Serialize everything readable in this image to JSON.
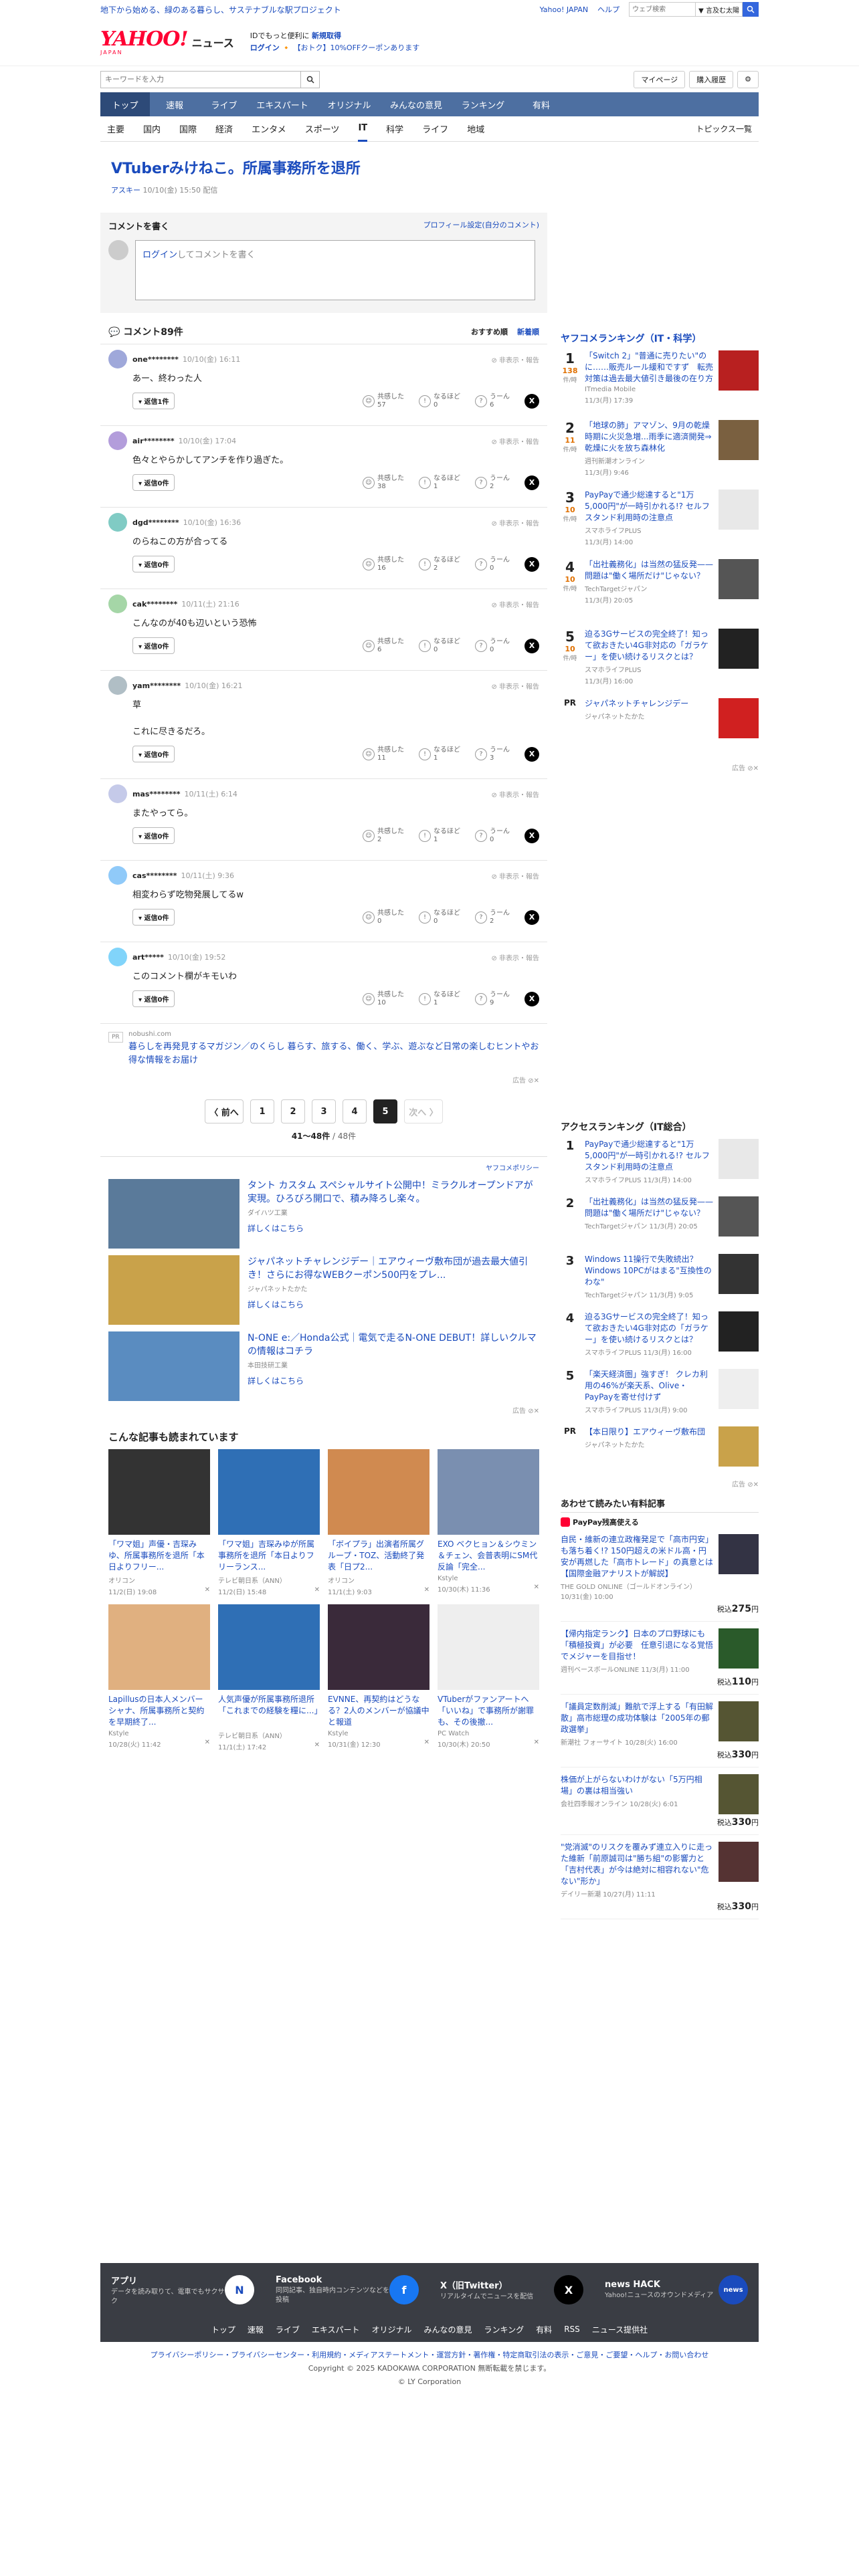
{
  "topbar": {
    "promo": "地下から始める、緑のある暮らし、サステナブルな駅プロジェクト",
    "links": [
      "Yahoo! JAPAN",
      "ヘルプ"
    ],
    "search_placeholder": "ウェブ検索",
    "search_button": "▼ 言及む太陽",
    "search_icon": "search-icon"
  },
  "header": {
    "logo": "YAHOO!",
    "logo_sub": "JAPAN",
    "section": "ニュース",
    "line1": "IDでもっと便利に",
    "line1_bold": "新規取得",
    "login": "ログイン",
    "line2": "【おトク】10%OFFクーポンあります"
  },
  "searchrow": {
    "placeholder": "キーワードを入力",
    "mypage": "マイページ",
    "purchase": "購入履歴",
    "settings_icon": "gear-icon"
  },
  "nav": [
    "トップ",
    "速報",
    "ライブ",
    "エキスパート",
    "オリジナル",
    "みんなの意見",
    "ランキング",
    "有料"
  ],
  "categories": [
    "主要",
    "国内",
    "国際",
    "経済",
    "エンタメ",
    "スポーツ",
    "IT",
    "科学",
    "ライフ",
    "地域"
  ],
  "topics_link": "トピックス一覧",
  "article": {
    "title": "VTuberみけねこ。所属事務所を退所",
    "source": "アスキー",
    "date": "10/10(金) 15:50 配信"
  },
  "comment_form": {
    "title": "コメントを書く",
    "profile_link": "プロフィール設定(自分のコメント)",
    "login_text": "ログイン",
    "prompt_text": "してコメントを書く"
  },
  "comments_head": {
    "title": "コメント89件",
    "sort_recommend": "おすすめ順",
    "sort_new": "新着順"
  },
  "labels": {
    "report": "非表示・報告",
    "reply": "返信",
    "empathy": "共感した",
    "naruhodo": "なるほど",
    "uun": "うーん"
  },
  "comments": [
    {
      "name": "one********",
      "date": "10/10(金) 16:11",
      "text": "あー、終わった人",
      "reply": "返信1件",
      "e": "57",
      "n": "0",
      "u": "6",
      "color": "#9fa8da"
    },
    {
      "name": "air********",
      "date": "10/10(金) 17:04",
      "text": "色々とやらかしてアンチを作り過ぎた。",
      "reply": "返信0件",
      "e": "38",
      "n": "1",
      "u": "2",
      "color": "#b39ddb"
    },
    {
      "name": "dgd********",
      "date": "10/10(金) 16:36",
      "text": "のらねこの方が合ってる",
      "reply": "返信0件",
      "e": "16",
      "n": "2",
      "u": "0",
      "color": "#80cbc4"
    },
    {
      "name": "cak********",
      "date": "10/11(土) 21:16",
      "text": "こんなのが40も辺いという恐怖",
      "reply": "返信0件",
      "e": "6",
      "n": "0",
      "u": "0",
      "color": "#a5d6a7"
    },
    {
      "name": "yam********",
      "date": "10/10(金) 16:21",
      "text": "草\n\nこれに尽きるだろ。",
      "reply": "返信0件",
      "e": "11",
      "n": "1",
      "u": "3",
      "color": "#b0bec5"
    },
    {
      "name": "mas********",
      "date": "10/11(土) 6:14",
      "text": "またやってら。",
      "reply": "返信0件",
      "e": "2",
      "n": "1",
      "u": "0",
      "color": "#c5cae9"
    },
    {
      "name": "cas********",
      "date": "10/11(土) 9:36",
      "text": "相変わらず吃物発展してるw",
      "reply": "返信0件",
      "e": "0",
      "n": "0",
      "u": "2",
      "color": "#90caf9"
    },
    {
      "name": "art*****",
      "date": "10/10(金) 19:52",
      "text": "このコメント欄がキモいわ",
      "reply": "返信0件",
      "e": "10",
      "n": "1",
      "u": "9",
      "color": "#81d4fa"
    }
  ],
  "list_ad": {
    "pr": "PR",
    "source": "nobushi.com",
    "text": "暮らしを再発見するマガジン／のくらし 暮らす、旅する、働く、学ぶ、遊ぶなど日常の楽しむヒントやお得な情報をお届け",
    "note": "広告 ⊘✕"
  },
  "pagination": {
    "prev": "〈 前へ",
    "pages": [
      "1",
      "2",
      "3",
      "4",
      "5"
    ],
    "current": "5",
    "next": "次へ 〉",
    "count": "41〜48件",
    "total": " / 48件"
  },
  "ads": {
    "policy": "ヤフコメポリシー",
    "items": [
      {
        "title": "タント カスタム スペシャルサイト公開中！ミラクルオープンドアが実現。ひろびろ開口で、積み降ろし楽々。",
        "sponsor": "ダイハツ工業",
        "more": "詳しくはこちら",
        "color": "#5a7a9a"
      },
      {
        "title": "ジャパネットチャレンジデー｜エアウィーヴ敷布団が過去最大値引き！さらにお得なWEBクーポン500円をプレ...",
        "sponsor": "ジャパネットたかた",
        "more": "詳しくはこちら",
        "color": "#c9a24a"
      },
      {
        "title": "N-ONE e:／Honda公式｜電気で走るN-ONE DEBUT！詳しいクルマの情報はコチラ",
        "sponsor": "本田技研工業",
        "more": "詳しくはこちら",
        "color": "#5a8cc0"
      }
    ],
    "note": "広告 ⊘✕"
  },
  "read_also": {
    "title": "こんな記事も読まれています",
    "items": [
      {
        "title": "「ワマ姐」声優・吉琛みゆ、所属事務所を退所「本日よりフリー...",
        "src": "オリコン",
        "date": "11/2(日) 19:08",
        "color": "#333"
      },
      {
        "title": "「ワマ姐」吉琛みゆが所属事務所を退所「本日よりフリーランス...",
        "src": "テレビ朝日系（ANN）",
        "date": "11/2(日) 15:48",
        "color": "#2f6fb5"
      },
      {
        "title": "「ボイプラ」出演者所属グループ・TOZ、活動終了発表「日プ2...",
        "src": "オリコン",
        "date": "11/1(土) 9:03",
        "color": "#d08a50"
      },
      {
        "title": "EXO ベクヒョン＆シウミン＆チェン、会普表明にSM代反論「完全...",
        "src": "Kstyle",
        "date": "10/30(木) 11:36",
        "color": "#7a8fb0"
      },
      {
        "title": "Lapillusの日本人メンバーシャナ、所属事務所と契約を早期終了...",
        "src": "Kstyle",
        "date": "10/28(火) 11:42",
        "color": "#e0b080"
      },
      {
        "title": "人気声優が所属事務所退所「これまでの経験を糧に...」",
        "src": "テレビ朝日系（ANN）",
        "date": "11/1(土) 17:42",
        "color": "#2f6fb5"
      },
      {
        "title": "EVNNE、再契約はどうなる？2人のメンバーが協議中と報道",
        "src": "Kstyle",
        "date": "10/31(金) 12:30",
        "color": "#3a2a3a"
      },
      {
        "title": "VTuberがファンアートへ「いいね」で事務所が謝罪も、その後撤...",
        "src": "PC Watch",
        "date": "10/30(木) 20:50",
        "color": "#eeeeee"
      }
    ]
  },
  "side_ranking": {
    "title": "ヤフコメランキング（IT・科学）",
    "unit": "件/時",
    "items": [
      {
        "num": "1",
        "cnt": "138",
        "title": "「Switch 2」\"普通に売りたい\"のに……販売ルール緩和ですず　転売対策は過去最大値引き最後の在り方",
        "src": "ITmedia Mobile",
        "date": "11/3(月) 17:39",
        "color": "#b82020"
      },
      {
        "num": "2",
        "cnt": "11",
        "title": "「地球の肺」アマゾン、9月の乾燥時期に火災急増...雨季に適済開発⇒乾燥に火を放ち森林化",
        "src": "週刊新潮オンライン",
        "date": "11/3(月) 9:46",
        "color": "#7a6040"
      },
      {
        "num": "3",
        "cnt": "10",
        "title": "PayPayで通少総達すると\"1万5,000円\"が一時引かれる!? セルフスタンド利用時の注意点",
        "src": "スマホライフPLUS",
        "date": "11/3(月) 14:00",
        "color": "#e8e8e8"
      },
      {
        "num": "4",
        "cnt": "10",
        "title": "「出社義務化」は当然の猛反発——問題は\"働く場所だけ\"じゃない？",
        "src": "TechTargetジャパン",
        "date": "11/3(月) 20:05",
        "color": "#555"
      },
      {
        "num": "5",
        "cnt": "10",
        "title": "迫る3Gサービスの完全終了！知って欲おきたい4G非対応の「ガラケー」を使い続けるリスクとは？",
        "src": "スマホライフPLUS",
        "date": "11/3(月) 16:00",
        "color": "#222"
      }
    ],
    "pr": {
      "label": "PR",
      "title": "ジャパネットチャレンジデー",
      "src": "ジャパネットたかた",
      "color": "#d02020"
    },
    "note": "広告 ⊘✕"
  },
  "side_access": {
    "title": "アクセスランキング（IT総合）",
    "items": [
      {
        "num": "1",
        "title": "PayPayで通少総達すると\"1万5,000円\"が一時引かれる!? セルフスタンド利用時の注意点",
        "src": "スマホライフPLUS 11/3(月) 14:00",
        "color": "#e8e8e8"
      },
      {
        "num": "2",
        "title": "「出社義務化」は当然の猛反発——問題は\"働く場所だけ\"じゃない？",
        "src": "TechTargetジャパン 11/3(月) 20:05",
        "color": "#555"
      },
      {
        "num": "3",
        "title": "Windows 11操行で失敗続出？Windows 10PCがはまる\"互換性のわな\"",
        "src": "TechTargetジャパン 11/3(月) 9:05",
        "color": "#333"
      },
      {
        "num": "4",
        "title": "迫る3Gサービスの完全終了！知って欲おきたい4G非対応の「ガラケー」を使い続けるリスクとは？",
        "src": "スマホライフPLUS 11/3(月) 16:00",
        "color": "#222"
      },
      {
        "num": "5",
        "title": "「楽天経済圏」強すぎ！ クレカ利用の46%が楽天系、Olive・PayPayを寄せ付けず",
        "src": "スマホライフPLUS 11/3(月) 9:00",
        "color": "#eee"
      }
    ],
    "pr": {
      "label": "PR",
      "title": "【本日限り】エアウィーヴ敷布団",
      "src": "ジャパネットたかた",
      "color": "#c9a24a"
    },
    "note": "広告 ⊘✕"
  },
  "side_shop": {
    "title": "あわせて読みたい有料記事",
    "badge": "PayPay残高使える",
    "items": [
      {
        "title": "自民・維新の連立政権発足で「高市円安」も落ち着く!? 150円超えの米ドル高・円安が再燃した「高市トレード」の真意とは【国際金融アナリストが解説】",
        "src": "THE GOLD ONLINE（ゴールドオンライン） 10/31(金) 10:00",
        "price": "275",
        "color": "#334"
      },
      {
        "title": "【帰内指定ランク】日本のプロ野球にも「積極投資」が必要　任意引退になる覚悟でメジャーを目指せ！",
        "src": "週刊ベースボールONLINE 11/3(月) 11:00",
        "price": "110",
        "color": "#2a5a2a"
      },
      {
        "title": "「議員定数削減」難航で浮上する「有田解散」高市総理の成功体験は「2005年の郵政選挙」",
        "src": "新潮社 フォーサイト 10/28(火) 16:00",
        "price": "330",
        "color": "#553"
      },
      {
        "title": "株価が上がらないわけがない「5万円相場」の裏は相当強い",
        "src": "会社四季報オンライン 10/28(火) 6:01",
        "price": "330",
        "color": "#553"
      },
      {
        "title": "\"党消滅\"のリスクを覆みず連立入りに走った維新「前原誠司は\"勝ち組\"の影響力と「吉村代表」が今は絶対に相容れない\"危ない\"形か」",
        "src": "デイリー新潮 10/27(月) 11:11",
        "price": "330",
        "color": "#533"
      }
    ],
    "price_prefix": "税込",
    "price_unit": "円"
  },
  "footer": {
    "apps": [
      {
        "title": "アプリ",
        "desc": "データを読み取りて、電車でもサクサク",
        "icon": "N",
        "color": "#fff",
        "fg": "#1a4bbd"
      },
      {
        "title": "Facebook",
        "desc": "同同記事、独自時内コンテンツなどを投稿",
        "icon": "f",
        "color": "#1877f2",
        "fg": "#fff"
      },
      {
        "title": "X（旧Twitter）",
        "desc": "リアルタイムでニュースを配信",
        "icon": "X",
        "color": "#000",
        "fg": "#fff"
      },
      {
        "title": "news HACK",
        "desc": "Yahoo!ニュースのオウンドメディア",
        "icon": "news",
        "color": "#1a4bbd",
        "fg": "#fff"
      }
    ],
    "links": [
      "トップ",
      "速報",
      "ライブ",
      "エキスパート",
      "オリジナル",
      "みんなの意見",
      "ランキング",
      "有料",
      "RSS",
      "ニュース提供社"
    ],
    "policy": "プライバシーポリシー・プライバシーセンター・利用規約・メディアステートメント・運営方針・著作権・特定商取引法の表示・ご意見・ご要望・ヘルプ・お問い合わせ",
    "copyright": "Copyright © 2025 KADOKAWA CORPORATION 無断転載を禁じます。",
    "ly": "© LY Corporation"
  }
}
